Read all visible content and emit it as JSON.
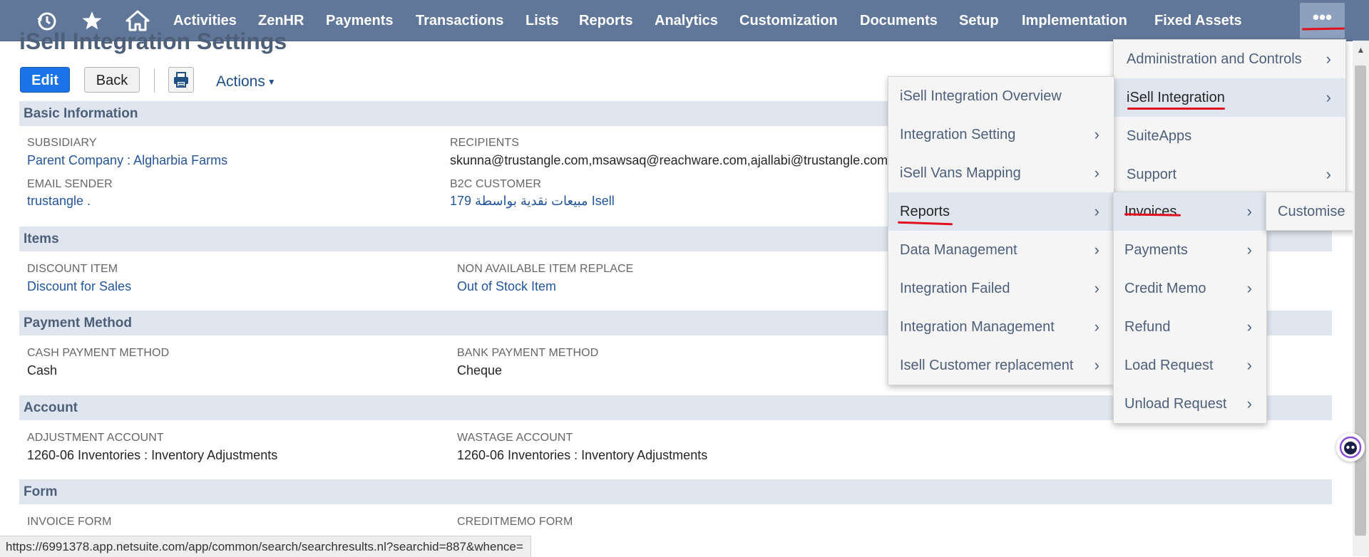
{
  "nav": {
    "icons": [
      "recent-icon",
      "star-icon",
      "home-icon"
    ],
    "items": [
      "Activities",
      "ZenHR",
      "Payments",
      "Transactions",
      "Lists",
      "Reports",
      "Analytics",
      "Customization",
      "Documents",
      "Setup",
      "Implementation",
      "Fixed Assets"
    ],
    "more_label": "•••",
    "bg_color": "#607799"
  },
  "page": {
    "title": "iSell Integration Settings",
    "edit_label": "Edit",
    "back_label": "Back",
    "actions_label": "Actions"
  },
  "sections": {
    "basic": {
      "title": "Basic Information",
      "subsidiary_label": "SUBSIDIARY",
      "subsidiary_value": "Parent Company : Algharbia Farms",
      "recipients_label": "RECIPIENTS",
      "recipients_value": "skunna@trustangle.com,msawsaq@reachware.com,ajallabi@trustangle.com",
      "email_sender_label": "EMAIL SENDER",
      "email_sender_value": "trustangle .",
      "b2c_label": "B2C CUSTOMER",
      "b2c_value": "179 مبيعات نقدية بواسطة Isell"
    },
    "items": {
      "title": "Items",
      "discount_label": "DISCOUNT ITEM",
      "discount_value": "Discount for Sales",
      "non_available_label": "NON AVAILABLE ITEM REPLACE",
      "non_available_value": "Out of Stock Item"
    },
    "payment": {
      "title": "Payment Method",
      "cash_label": "CASH PAYMENT METHOD",
      "cash_value": "Cash",
      "bank_label": "BANK PAYMENT METHOD",
      "bank_value": "Cheque"
    },
    "account": {
      "title": "Account",
      "adjustment_label": "ADJUSTMENT ACCOUNT",
      "adjustment_value": "1260-06 Inventories : Inventory Adjustments",
      "wastage_label": "WASTAGE ACCOUNT",
      "wastage_value": "1260-06 Inventories : Inventory Adjustments"
    },
    "form": {
      "title": "Form",
      "invoice_label": "INVOICE FORM",
      "creditmemo_label": "CREDITMEMO FORM"
    }
  },
  "menus": {
    "level1": [
      {
        "label": "Administration and Controls",
        "has_sub": true
      },
      {
        "label": "iSell Integration",
        "has_sub": true,
        "active": true
      },
      {
        "label": "SuiteApps",
        "has_sub": false
      },
      {
        "label": "Support",
        "has_sub": true
      }
    ],
    "level2": [
      {
        "label": "iSell Integration Overview",
        "has_sub": false
      },
      {
        "label": "Integration Setting",
        "has_sub": true
      },
      {
        "label": "iSell Vans Mapping",
        "has_sub": true
      },
      {
        "label": "Reports",
        "has_sub": true,
        "active": true
      },
      {
        "label": "Data Management",
        "has_sub": true
      },
      {
        "label": "Integration Failed",
        "has_sub": true
      },
      {
        "label": "Integration Management",
        "has_sub": true
      },
      {
        "label": "Isell Customer replacement",
        "has_sub": true
      }
    ],
    "level3": [
      {
        "label": "Invoices",
        "has_sub": true,
        "active": true
      },
      {
        "label": "Payments",
        "has_sub": true
      },
      {
        "label": "Credit Memo",
        "has_sub": true
      },
      {
        "label": "Refund",
        "has_sub": true
      },
      {
        "label": "Load Request",
        "has_sub": true
      },
      {
        "label": "Unload Request",
        "has_sub": true
      }
    ],
    "level4": [
      {
        "label": "Customise",
        "has_sub": false
      }
    ]
  },
  "status_url": "https://6991378.app.netsuite.com/app/common/search/searchresults.nl?searchid=887&whence=",
  "accent_color": "#1a73e8",
  "annotation_color": "#e0101c"
}
